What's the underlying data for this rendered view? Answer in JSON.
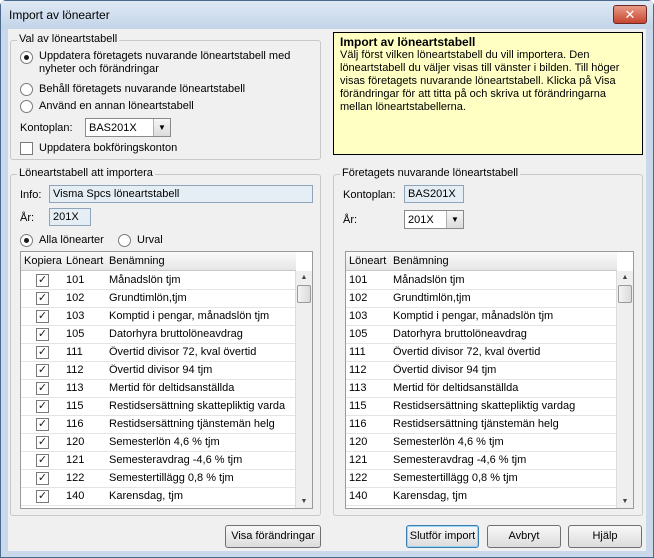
{
  "window": {
    "title": "Import av lönearter",
    "close_label": "✕"
  },
  "val": {
    "legend": "Val av löneartstabell",
    "options": [
      {
        "label": "Uppdatera företagets nuvarande löneartstabell med nyheter och förändringar",
        "selected": true
      },
      {
        "label": "Behåll företagets nuvarande löneartstabell",
        "selected": false
      },
      {
        "label": "Använd en annan löneartstabell",
        "selected": false
      }
    ],
    "kontoplan_label": "Kontoplan:",
    "kontoplan_value": "BAS201X",
    "update_accounts_label": "Uppdatera bokföringskonton",
    "update_accounts_checked": false
  },
  "info": {
    "title": "Import av löneartstabell",
    "body": "Välj först vilken löneartstabell du vill importera. Den löneartstabell du väljer visas till vänster i bilden. Till höger visas företagets nuvarande löneartstabell. Klicka på Visa förändringar för att titta på och skriva ut förändringarna mellan löneartstabellerna."
  },
  "import": {
    "legend": "Löneartstabell att importera",
    "info_label": "Info:",
    "info_value": "Visma Spcs löneartstabell",
    "year_label": "År:",
    "year_value": "201X",
    "all_label": "Alla lönearter",
    "all_selected": true,
    "selection_label": "Urval",
    "selection_selected": false,
    "columns": [
      "Kopiera",
      "Löneart",
      "Benämning"
    ],
    "rows": [
      {
        "copy": true,
        "code": "101",
        "name": "Månadslön tjm"
      },
      {
        "copy": true,
        "code": "102",
        "name": "Grundtimlön,tjm"
      },
      {
        "copy": true,
        "code": "103",
        "name": "Komptid i pengar, månadslön tjm"
      },
      {
        "copy": true,
        "code": "105",
        "name": "Datorhyra bruttolöneavdrag"
      },
      {
        "copy": true,
        "code": "111",
        "name": "Övertid divisor 72, kval övertid"
      },
      {
        "copy": true,
        "code": "112",
        "name": "Övertid divisor 94 tjm"
      },
      {
        "copy": true,
        "code": "113",
        "name": "Mertid för deltidsanställda"
      },
      {
        "copy": true,
        "code": "115",
        "name": "Restidsersättning skattepliktig varda"
      },
      {
        "copy": true,
        "code": "116",
        "name": "Restidsersättning tjänstemän helg"
      },
      {
        "copy": true,
        "code": "120",
        "name": "Semesterlön 4,6 % tjm"
      },
      {
        "copy": true,
        "code": "121",
        "name": "Semesteravdrag -4,6 % tjm"
      },
      {
        "copy": true,
        "code": "122",
        "name": "Semestertillägg 0,8 % tjm"
      },
      {
        "copy": true,
        "code": "140",
        "name": "Karensdag, tjm"
      }
    ]
  },
  "current": {
    "legend": "Företagets nuvarande löneartstabell",
    "kontoplan_label": "Kontoplan:",
    "kontoplan_value": "BAS201X",
    "year_label": "År:",
    "year_value": "201X",
    "columns": [
      "Löneart",
      "Benämning"
    ],
    "rows": [
      {
        "code": "101",
        "name": "Månadslön tjm"
      },
      {
        "code": "102",
        "name": "Grundtimlön,tjm"
      },
      {
        "code": "103",
        "name": "Komptid i pengar, månadslön tjm"
      },
      {
        "code": "105",
        "name": "Datorhyra bruttolöneavdrag"
      },
      {
        "code": "111",
        "name": "Övertid divisor 72, kval övertid"
      },
      {
        "code": "112",
        "name": "Övertid divisor 94 tjm"
      },
      {
        "code": "113",
        "name": "Mertid för deltidsanställda"
      },
      {
        "code": "115",
        "name": "Restidsersättning skattepliktig vardag"
      },
      {
        "code": "116",
        "name": "Restidsersättning tjänstemän helg"
      },
      {
        "code": "120",
        "name": "Semesterlön 4,6 % tjm"
      },
      {
        "code": "121",
        "name": "Semesteravdrag -4,6 % tjm"
      },
      {
        "code": "122",
        "name": "Semestertillägg 0,8 % tjm"
      },
      {
        "code": "140",
        "name": "Karensdag, tjm"
      }
    ]
  },
  "buttons": {
    "show_changes": "Visa förändringar",
    "finish": "Slutför import",
    "cancel": "Avbryt",
    "help": "Hjälp"
  }
}
